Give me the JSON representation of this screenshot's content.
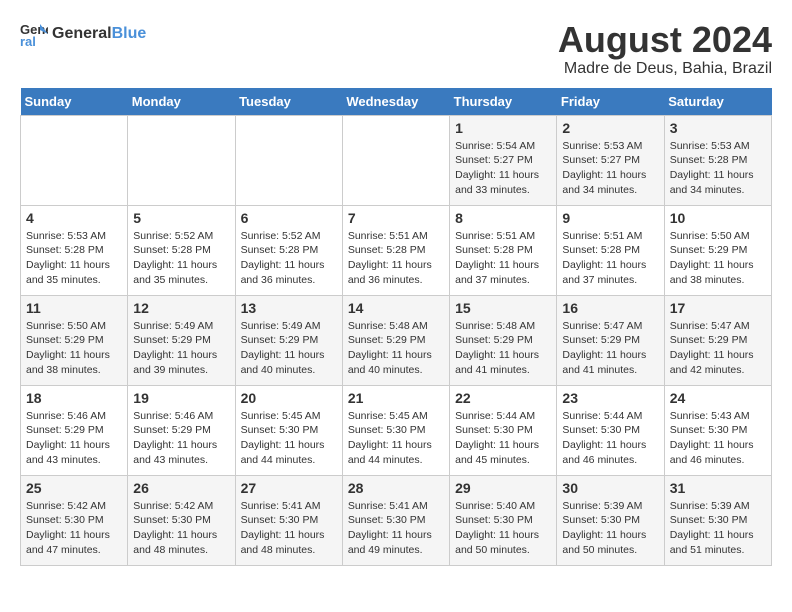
{
  "header": {
    "logo_line1": "General",
    "logo_line2": "Blue",
    "title": "August 2024",
    "subtitle": "Madre de Deus, Bahia, Brazil"
  },
  "weekdays": [
    "Sunday",
    "Monday",
    "Tuesday",
    "Wednesday",
    "Thursday",
    "Friday",
    "Saturday"
  ],
  "weeks": [
    [
      {
        "day": "",
        "info": ""
      },
      {
        "day": "",
        "info": ""
      },
      {
        "day": "",
        "info": ""
      },
      {
        "day": "",
        "info": ""
      },
      {
        "day": "1",
        "info": "Sunrise: 5:54 AM\nSunset: 5:27 PM\nDaylight: 11 hours\nand 33 minutes."
      },
      {
        "day": "2",
        "info": "Sunrise: 5:53 AM\nSunset: 5:27 PM\nDaylight: 11 hours\nand 34 minutes."
      },
      {
        "day": "3",
        "info": "Sunrise: 5:53 AM\nSunset: 5:28 PM\nDaylight: 11 hours\nand 34 minutes."
      }
    ],
    [
      {
        "day": "4",
        "info": "Sunrise: 5:53 AM\nSunset: 5:28 PM\nDaylight: 11 hours\nand 35 minutes."
      },
      {
        "day": "5",
        "info": "Sunrise: 5:52 AM\nSunset: 5:28 PM\nDaylight: 11 hours\nand 35 minutes."
      },
      {
        "day": "6",
        "info": "Sunrise: 5:52 AM\nSunset: 5:28 PM\nDaylight: 11 hours\nand 36 minutes."
      },
      {
        "day": "7",
        "info": "Sunrise: 5:51 AM\nSunset: 5:28 PM\nDaylight: 11 hours\nand 36 minutes."
      },
      {
        "day": "8",
        "info": "Sunrise: 5:51 AM\nSunset: 5:28 PM\nDaylight: 11 hours\nand 37 minutes."
      },
      {
        "day": "9",
        "info": "Sunrise: 5:51 AM\nSunset: 5:28 PM\nDaylight: 11 hours\nand 37 minutes."
      },
      {
        "day": "10",
        "info": "Sunrise: 5:50 AM\nSunset: 5:29 PM\nDaylight: 11 hours\nand 38 minutes."
      }
    ],
    [
      {
        "day": "11",
        "info": "Sunrise: 5:50 AM\nSunset: 5:29 PM\nDaylight: 11 hours\nand 38 minutes."
      },
      {
        "day": "12",
        "info": "Sunrise: 5:49 AM\nSunset: 5:29 PM\nDaylight: 11 hours\nand 39 minutes."
      },
      {
        "day": "13",
        "info": "Sunrise: 5:49 AM\nSunset: 5:29 PM\nDaylight: 11 hours\nand 40 minutes."
      },
      {
        "day": "14",
        "info": "Sunrise: 5:48 AM\nSunset: 5:29 PM\nDaylight: 11 hours\nand 40 minutes."
      },
      {
        "day": "15",
        "info": "Sunrise: 5:48 AM\nSunset: 5:29 PM\nDaylight: 11 hours\nand 41 minutes."
      },
      {
        "day": "16",
        "info": "Sunrise: 5:47 AM\nSunset: 5:29 PM\nDaylight: 11 hours\nand 41 minutes."
      },
      {
        "day": "17",
        "info": "Sunrise: 5:47 AM\nSunset: 5:29 PM\nDaylight: 11 hours\nand 42 minutes."
      }
    ],
    [
      {
        "day": "18",
        "info": "Sunrise: 5:46 AM\nSunset: 5:29 PM\nDaylight: 11 hours\nand 43 minutes."
      },
      {
        "day": "19",
        "info": "Sunrise: 5:46 AM\nSunset: 5:29 PM\nDaylight: 11 hours\nand 43 minutes."
      },
      {
        "day": "20",
        "info": "Sunrise: 5:45 AM\nSunset: 5:30 PM\nDaylight: 11 hours\nand 44 minutes."
      },
      {
        "day": "21",
        "info": "Sunrise: 5:45 AM\nSunset: 5:30 PM\nDaylight: 11 hours\nand 44 minutes."
      },
      {
        "day": "22",
        "info": "Sunrise: 5:44 AM\nSunset: 5:30 PM\nDaylight: 11 hours\nand 45 minutes."
      },
      {
        "day": "23",
        "info": "Sunrise: 5:44 AM\nSunset: 5:30 PM\nDaylight: 11 hours\nand 46 minutes."
      },
      {
        "day": "24",
        "info": "Sunrise: 5:43 AM\nSunset: 5:30 PM\nDaylight: 11 hours\nand 46 minutes."
      }
    ],
    [
      {
        "day": "25",
        "info": "Sunrise: 5:42 AM\nSunset: 5:30 PM\nDaylight: 11 hours\nand 47 minutes."
      },
      {
        "day": "26",
        "info": "Sunrise: 5:42 AM\nSunset: 5:30 PM\nDaylight: 11 hours\nand 48 minutes."
      },
      {
        "day": "27",
        "info": "Sunrise: 5:41 AM\nSunset: 5:30 PM\nDaylight: 11 hours\nand 48 minutes."
      },
      {
        "day": "28",
        "info": "Sunrise: 5:41 AM\nSunset: 5:30 PM\nDaylight: 11 hours\nand 49 minutes."
      },
      {
        "day": "29",
        "info": "Sunrise: 5:40 AM\nSunset: 5:30 PM\nDaylight: 11 hours\nand 50 minutes."
      },
      {
        "day": "30",
        "info": "Sunrise: 5:39 AM\nSunset: 5:30 PM\nDaylight: 11 hours\nand 50 minutes."
      },
      {
        "day": "31",
        "info": "Sunrise: 5:39 AM\nSunset: 5:30 PM\nDaylight: 11 hours\nand 51 minutes."
      }
    ]
  ]
}
